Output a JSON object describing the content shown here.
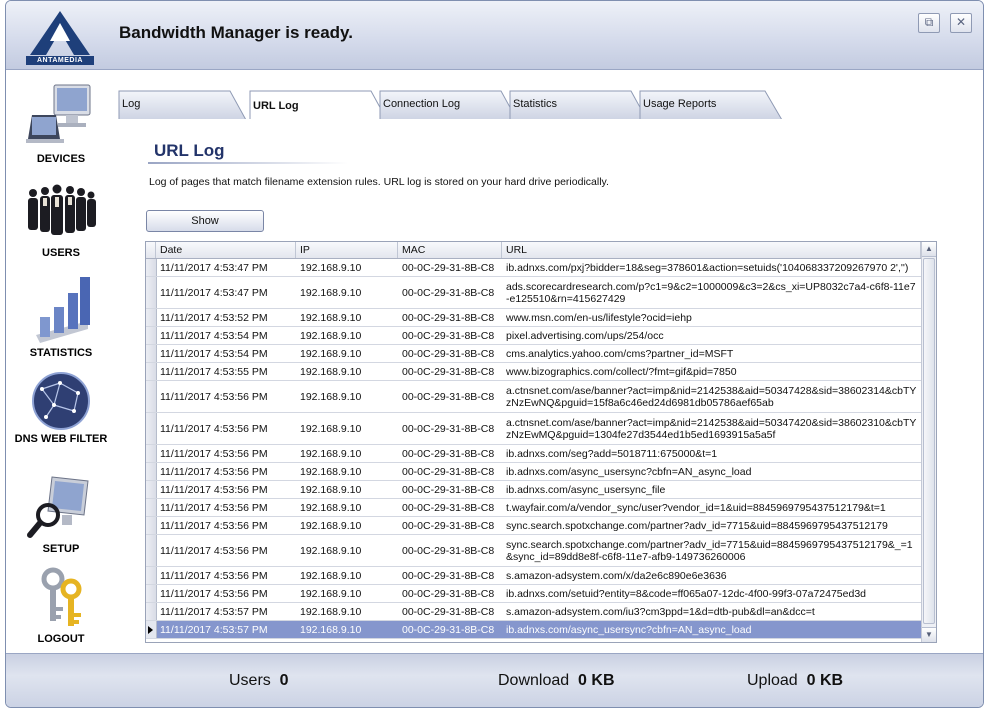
{
  "header": {
    "status_text": "Bandwidth Manager is ready.",
    "logo_text": "ANTAMEDIA",
    "restore_icon": "restore-icon",
    "close_icon": "close-icon"
  },
  "sidebar": {
    "items": [
      {
        "label": "DEVICES",
        "icon": "computer-icon"
      },
      {
        "label": "USERS",
        "icon": "users-group-icon"
      },
      {
        "label": "STATISTICS",
        "icon": "bar-chart-icon"
      },
      {
        "label": "DNS WEB FILTER",
        "icon": "globe-icon"
      },
      {
        "label": "SETUP",
        "icon": "monitor-magnifier-icon"
      },
      {
        "label": "LOGOUT",
        "icon": "keys-icon"
      }
    ]
  },
  "tabs": [
    {
      "label": "Log",
      "active": false
    },
    {
      "label": "URL Log",
      "active": true
    },
    {
      "label": "Connection Log",
      "active": false
    },
    {
      "label": "Statistics",
      "active": false
    },
    {
      "label": "Usage Reports",
      "active": false
    }
  ],
  "main": {
    "title": "URL Log",
    "description": "Log of pages that match filename extension rules. URL log is stored on your hard drive periodically.",
    "show_button": "Show"
  },
  "grid": {
    "columns": [
      "Date",
      "IP",
      "MAC",
      "URL"
    ],
    "rows": [
      {
        "date": "11/11/2017 4:53:47 PM",
        "ip": "192.168.9.10",
        "mac": "00-0C-29-31-8B-C8",
        "url": "ib.adnxs.com/pxj?bidder=18&seg=378601&action=setuids('104068337209267970 2','')",
        "lines": 1
      },
      {
        "date": "11/11/2017 4:53:47 PM",
        "ip": "192.168.9.10",
        "mac": "00-0C-29-31-8B-C8",
        "url": "ads.scorecardresearch.com/p?c1=9&c2=1000009&c3=2&cs_xi=UP8032c7a4-c6f8-11e7-e125510&rn=415627429",
        "lines": 2
      },
      {
        "date": "11/11/2017 4:53:52 PM",
        "ip": "192.168.9.10",
        "mac": "00-0C-29-31-8B-C8",
        "url": "www.msn.com/en-us/lifestyle?ocid=iehp",
        "lines": 1
      },
      {
        "date": "11/11/2017 4:53:54 PM",
        "ip": "192.168.9.10",
        "mac": "00-0C-29-31-8B-C8",
        "url": "pixel.advertising.com/ups/254/occ",
        "lines": 1
      },
      {
        "date": "11/11/2017 4:53:54 PM",
        "ip": "192.168.9.10",
        "mac": "00-0C-29-31-8B-C8",
        "url": "cms.analytics.yahoo.com/cms?partner_id=MSFT",
        "lines": 1
      },
      {
        "date": "11/11/2017 4:53:55 PM",
        "ip": "192.168.9.10",
        "mac": "00-0C-29-31-8B-C8",
        "url": "www.bizographics.com/collect/?fmt=gif&pid=7850",
        "lines": 1
      },
      {
        "date": "11/11/2017 4:53:56 PM",
        "ip": "192.168.9.10",
        "mac": "00-0C-29-31-8B-C8",
        "url": "a.ctnsnet.com/ase/banner?act=imp&nid=2142538&aid=50347428&sid=38602314&cbTYzNzEwNQ&pguid=15f8a6c46ed24d6981db05786aef65ab",
        "lines": 2
      },
      {
        "date": "11/11/2017 4:53:56 PM",
        "ip": "192.168.9.10",
        "mac": "00-0C-29-31-8B-C8",
        "url": "a.ctnsnet.com/ase/banner?act=imp&nid=2142538&aid=50347420&sid=38602310&cbTYzNzEwMQ&pguid=1304fe27d3544ed1b5ed1693915a5a5f",
        "lines": 2
      },
      {
        "date": "11/11/2017 4:53:56 PM",
        "ip": "192.168.9.10",
        "mac": "00-0C-29-31-8B-C8",
        "url": "ib.adnxs.com/seg?add=5018711:675000&t=1",
        "lines": 1
      },
      {
        "date": "11/11/2017 4:53:56 PM",
        "ip": "192.168.9.10",
        "mac": "00-0C-29-31-8B-C8",
        "url": "ib.adnxs.com/async_usersync?cbfn=AN_async_load",
        "lines": 1
      },
      {
        "date": "11/11/2017 4:53:56 PM",
        "ip": "192.168.9.10",
        "mac": "00-0C-29-31-8B-C8",
        "url": "ib.adnxs.com/async_usersync_file",
        "lines": 1
      },
      {
        "date": "11/11/2017 4:53:56 PM",
        "ip": "192.168.9.10",
        "mac": "00-0C-29-31-8B-C8",
        "url": "t.wayfair.com/a/vendor_sync/user?vendor_id=1&uid=8845969795437512179&t=1",
        "lines": 1
      },
      {
        "date": "11/11/2017 4:53:56 PM",
        "ip": "192.168.9.10",
        "mac": "00-0C-29-31-8B-C8",
        "url": "sync.search.spotxchange.com/partner?adv_id=7715&uid=8845969795437512179",
        "lines": 1
      },
      {
        "date": "11/11/2017 4:53:56 PM",
        "ip": "192.168.9.10",
        "mac": "00-0C-29-31-8B-C8",
        "url": "sync.search.spotxchange.com/partner?adv_id=7715&uid=8845969795437512179&_=1&sync_id=89dd8e8f-c6f8-11e7-afb9-149736260006",
        "lines": 2
      },
      {
        "date": "11/11/2017 4:53:56 PM",
        "ip": "192.168.9.10",
        "mac": "00-0C-29-31-8B-C8",
        "url": "s.amazon-adsystem.com/x/da2e6c890e6e3636",
        "lines": 1
      },
      {
        "date": "11/11/2017 4:53:56 PM",
        "ip": "192.168.9.10",
        "mac": "00-0C-29-31-8B-C8",
        "url": "ib.adnxs.com/setuid?entity=8&code=ff065a07-12dc-4f00-99f3-07a72475ed3d",
        "lines": 1
      },
      {
        "date": "11/11/2017 4:53:57 PM",
        "ip": "192.168.9.10",
        "mac": "00-0C-29-31-8B-C8",
        "url": "s.amazon-adsystem.com/iu3?cm3ppd=1&d=dtb-pub&dl=an&dcc=t",
        "lines": 1
      },
      {
        "date": "11/11/2017 4:53:57 PM",
        "ip": "192.168.9.10",
        "mac": "00-0C-29-31-8B-C8",
        "url": "ib.adnxs.com/async_usersync?cbfn=AN_async_load",
        "lines": 1,
        "selected": true
      }
    ]
  },
  "footer": {
    "users_label": "Users",
    "users_value": "0",
    "download_label": "Download",
    "download_value": "0 KB",
    "upload_label": "Upload",
    "upload_value": "0 KB"
  },
  "colors": {
    "accent": "#23346a",
    "selection": "#8596cd",
    "header_bg": "#d6dcec"
  }
}
